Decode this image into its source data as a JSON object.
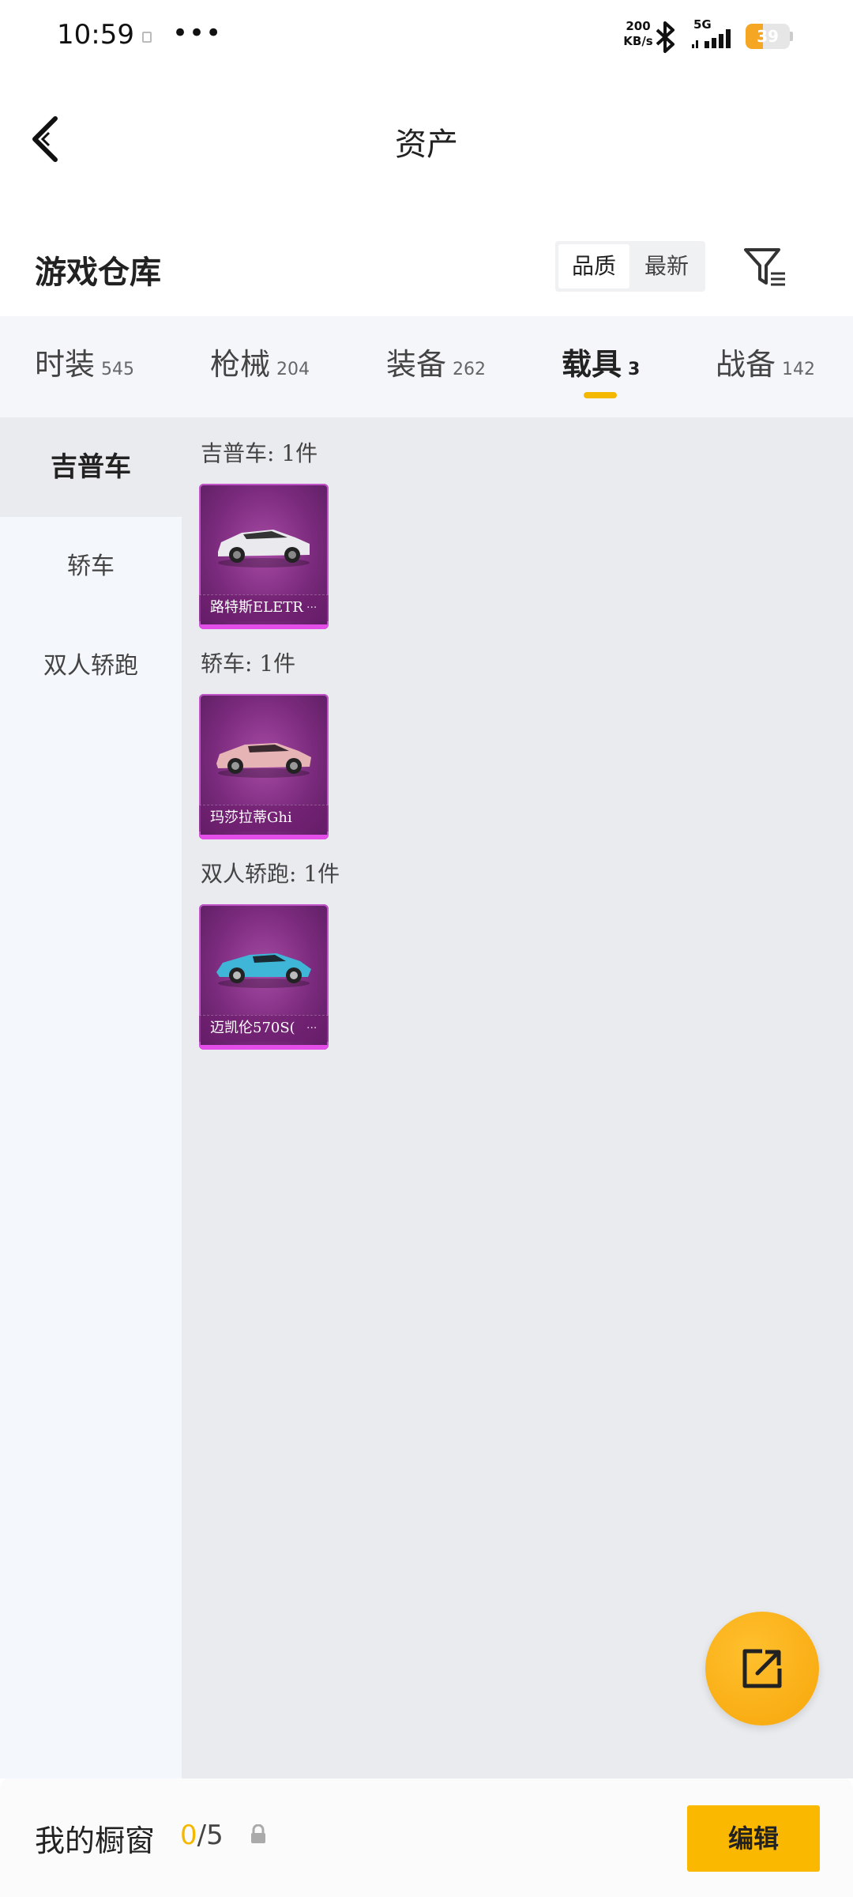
{
  "status_bar": {
    "time": "10:59",
    "dots": "•••",
    "net_speed_value": "200",
    "net_speed_unit": "KB/s",
    "network_type": "5G",
    "battery_level": "39",
    "battery_fraction": 0.39,
    "battery_color": "#f5a623",
    "icons": [
      "sim-icon",
      "bluetooth-icon",
      "signal-icon",
      "battery-icon"
    ]
  },
  "header": {
    "title": "资产",
    "back_icon": "chevron-left-icon"
  },
  "warehouse": {
    "title": "游戏仓库",
    "sort_options": [
      "品质",
      "最新"
    ],
    "sort_selected": "品质",
    "filter_icon": "filter-icon"
  },
  "categories": [
    {
      "label": "时装",
      "count": "545"
    },
    {
      "label": "枪械",
      "count": "204"
    },
    {
      "label": "装备",
      "count": "262"
    },
    {
      "label": "载具",
      "count": "3"
    },
    {
      "label": "战备",
      "count": "142"
    }
  ],
  "active_category": "载具",
  "accent_color": "#f5b800",
  "side_menu": [
    "吉普车",
    "轿车",
    "双人轿跑"
  ],
  "side_menu_active": "吉普车",
  "groups": [
    {
      "title": "吉普车: 1件",
      "items": [
        {
          "name": "路特斯ELETR",
          "more": "···",
          "car_color": "#e9e9ee"
        }
      ]
    },
    {
      "title": "轿车: 1件",
      "items": [
        {
          "name": "玛莎拉蒂Ghi",
          "more": "",
          "car_color": "#e7b4b6"
        }
      ]
    },
    {
      "title": "双人轿跑: 1件",
      "items": [
        {
          "name": "迈凯伦570S(",
          "more": "···",
          "car_color": "#3fb6d8"
        }
      ]
    }
  ],
  "fab": {
    "icon": "share-icon"
  },
  "showcase": {
    "label": "我的橱窗",
    "current": "0",
    "total": "/5",
    "lock_icon": "lock-icon",
    "edit_label": "编辑"
  }
}
